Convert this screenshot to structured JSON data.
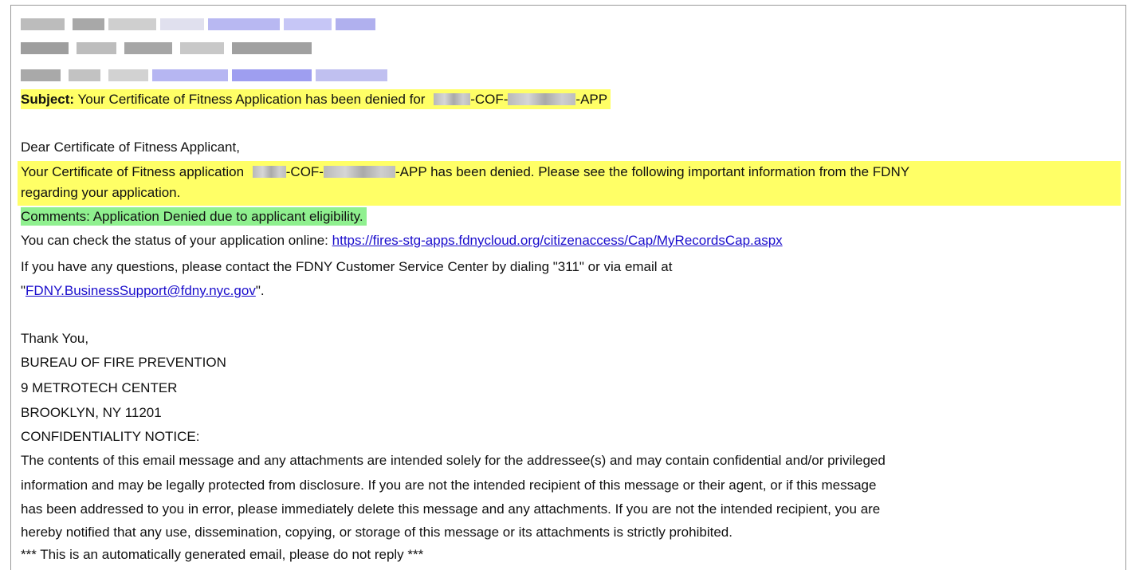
{
  "header": {
    "subject_label": "Subject:",
    "subject_text_before": "Your Certificate of Fitness Application has been denied for",
    "subject_cof": "-COF-",
    "subject_app": "-APP"
  },
  "body": {
    "greeting": "Dear Certificate of Fitness Applicant,",
    "denial_line1_before": "Your Certificate of Fitness application",
    "denial_cof": "-COF-",
    "denial_line1_after": "-APP has been denied. Please see the following important information from the FDNY",
    "denial_line2": "regarding your application.",
    "comments": "Comments: Application Denied due to applicant eligibility.",
    "status_text": "You can check the status of your application online: ",
    "status_link": "https://fires-stg-apps.fdnycloud.org/citizenaccess/Cap/MyRecordsCap.aspx",
    "questions_line1": "If you have any questions, please contact the FDNY Customer Service Center by dialing \"311\" or via email at",
    "email_quote_open": "\"",
    "email_link": "FDNY.BusinessSupport@fdny.nyc.gov",
    "email_quote_close": "\".",
    "thanks": "Thank You,",
    "bureau": "BUREAU OF FIRE PREVENTION",
    "address1": "9 METROTECH CENTER",
    "address2": "BROOKLYN, NY 11201",
    "conf_heading": "CONFIDENTIALITY NOTICE:",
    "conf_lines": [
      "The contents of this email message and any attachments are intended solely for the addressee(s) and may contain confidential and/or privileged",
      "information and may be legally protected from disclosure. If you are not the intended recipient of this message or their agent, or if this message",
      "has been addressed to you in error, please immediately delete this message and any attachments. If you are not the intended recipient, you are",
      "hereby notified that any use, dissemination, copying, or storage of this message or its attachments is strictly prohibited."
    ],
    "auto_notice": "*** This is an automatically generated email, please do not reply ***"
  },
  "colors": {
    "highlight_yellow": "#ffff66",
    "highlight_green": "#8ff08f",
    "link": "#1a0dcc"
  }
}
